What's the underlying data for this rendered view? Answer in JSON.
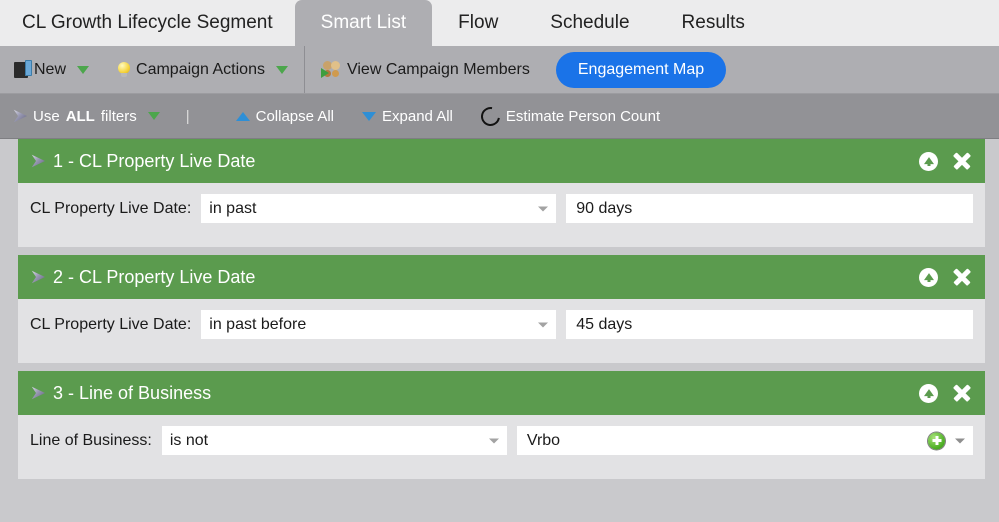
{
  "tabs": [
    {
      "label": "CL Growth Lifecycle Segment",
      "active": false
    },
    {
      "label": "Smart List",
      "active": true
    },
    {
      "label": "Flow",
      "active": false
    },
    {
      "label": "Schedule",
      "active": false
    },
    {
      "label": "Results",
      "active": false
    }
  ],
  "toolbar": {
    "new_label": "New",
    "campaign_actions_label": "Campaign Actions",
    "view_members_label": "View Campaign Members",
    "engagement_map_label": "Engagement Map",
    "accent_blue": "#1a73e8"
  },
  "filterbar": {
    "use_filters_prefix": "Use ",
    "use_filters_strong": "ALL",
    "use_filters_suffix": " filters",
    "separator": "|",
    "collapse_all_label": "Collapse All",
    "expand_all_label": "Expand All",
    "estimate_label": "Estimate Person Count"
  },
  "filters": [
    {
      "title": "1 - CL Property Live Date",
      "label": "CL Property Live Date:",
      "operator": "in past",
      "value": "90 days",
      "has_plus": false,
      "header_color": "#5b9b4e"
    },
    {
      "title": "2 - CL Property Live Date",
      "label": "CL Property Live Date:",
      "operator": "in past before",
      "value": "45 days",
      "has_plus": false,
      "header_color": "#5b9b4e"
    },
    {
      "title": "3 - Line of Business",
      "label": "Line of Business:",
      "operator": "is not",
      "value": "Vrbo",
      "has_plus": true,
      "header_color": "#5b9b4e"
    }
  ]
}
